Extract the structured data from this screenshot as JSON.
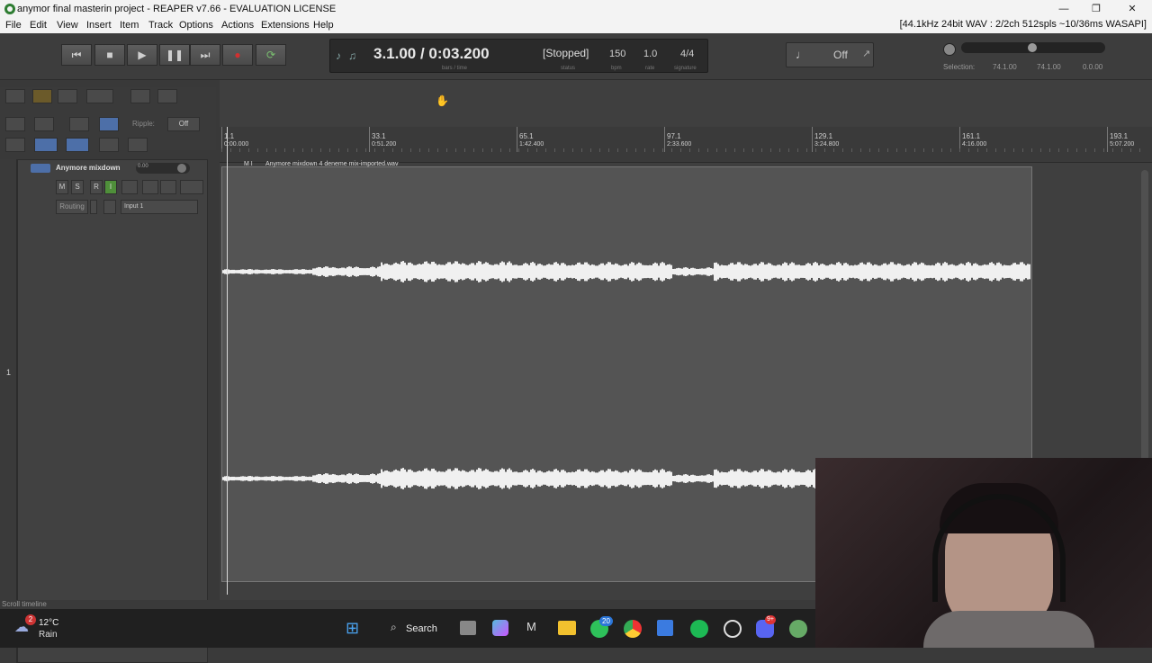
{
  "window": {
    "title": "anymor final masterin project - REAPER v7.66 - EVALUATION LICENSE",
    "controls": [
      "—",
      "❐",
      "✕"
    ]
  },
  "menu": {
    "items": [
      "File",
      "Edit",
      "View",
      "Insert",
      "Item",
      "Track",
      "Options",
      "Actions",
      "Extensions",
      "Help"
    ],
    "audio_status": "[44.1kHz 24bit WAV : 2/2ch 512spls ~10/36ms WASAPI]"
  },
  "transport": {
    "time": "3.1.00 / 0:03.200",
    "time_sub": "bars / time",
    "status": "[Stopped]",
    "status_sub": "status",
    "bpm": "150",
    "bpm_sub": "bpm",
    "rate": "1.0",
    "rate_sub": "rate",
    "signature": "4/4",
    "signature_sub": "signature",
    "metronome_state": "Off",
    "selection_label": "Selection:",
    "selection_start": "74.1.00",
    "selection_end": "74.1.00",
    "selection_length": "0.0.00"
  },
  "tcp": {
    "ripple_label": "Ripple:",
    "ripple_value": "Off",
    "track_number": "1",
    "track_name": "Anymore mixdown",
    "volume_readout": "0.00",
    "buttons": [
      "M",
      "S",
      "R",
      "I"
    ],
    "routing_label": "Routing",
    "input_value": "Input 1"
  },
  "ruler": {
    "marks": [
      {
        "bar": "1.1",
        "time": "0:00.000"
      },
      {
        "bar": "33.1",
        "time": "0:51.200"
      },
      {
        "bar": "65.1",
        "time": "1:42.400"
      },
      {
        "bar": "97.1",
        "time": "2:33.600"
      },
      {
        "bar": "129.1",
        "time": "3:24.800"
      },
      {
        "bar": "161.1",
        "time": "4:16.000"
      },
      {
        "bar": "193.1",
        "time": "5:07.200"
      }
    ]
  },
  "item": {
    "name": "Anymore mixdown 4 deneme mix-imported.wav",
    "flags": "M I"
  },
  "statusbar": {
    "text": "Scroll timeline"
  },
  "taskbar": {
    "weather_temp": "12°C",
    "weather_desc": "Rain",
    "weather_badge": "2",
    "search_label": "Search",
    "whatsapp_badge": "20",
    "discord_badge": "9+"
  }
}
